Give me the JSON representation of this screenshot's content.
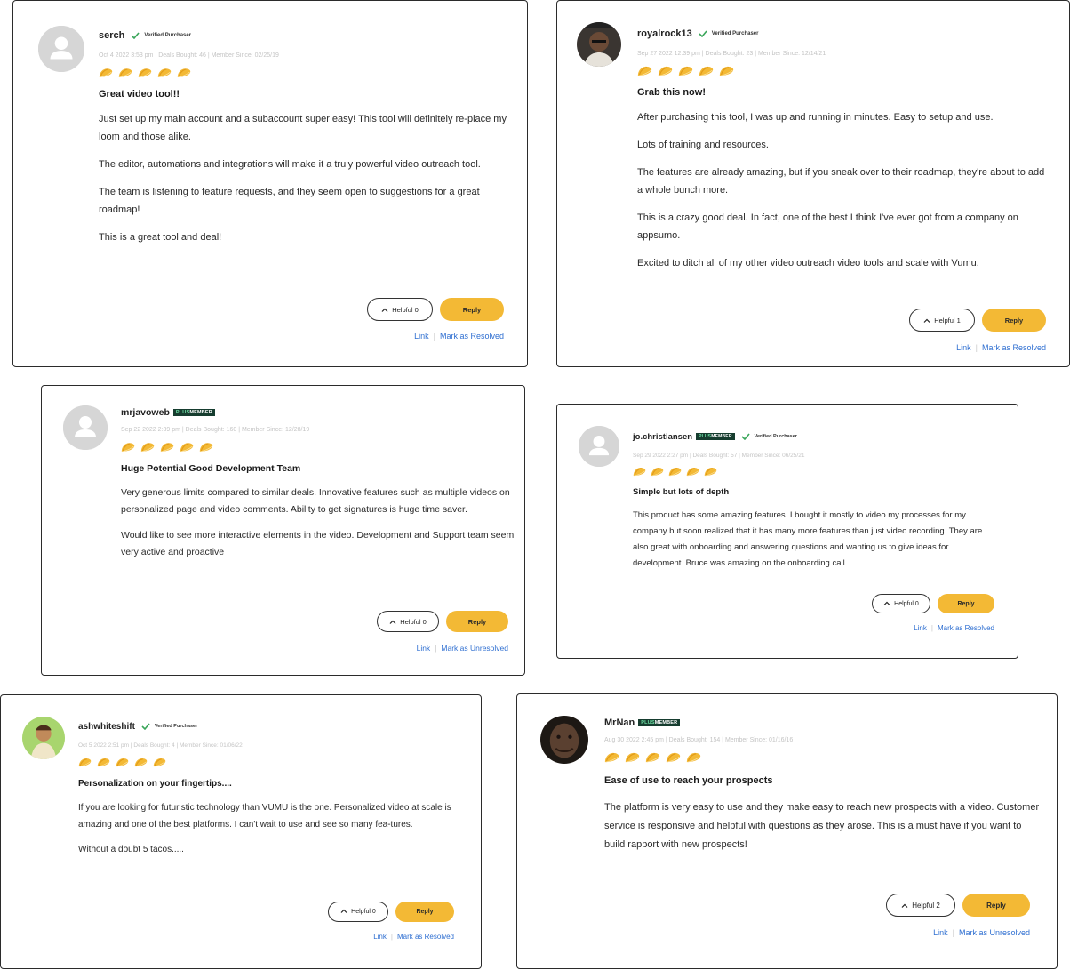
{
  "labels": {
    "verified": "Verified Purchaser",
    "plus": "PLUS",
    "member": "MEMBER",
    "helpful_prefix": "Helpful",
    "reply": "Reply",
    "link": "Link"
  },
  "colors": {
    "reply_button": "#f3b935",
    "link": "#2f6fd1",
    "verified_check": "#3aa65a",
    "plus_badge_bg": "#163d2f",
    "taco": "#f3b935"
  },
  "reviews": [
    {
      "username": "serch",
      "verified": true,
      "plus_member": false,
      "meta": "Oct 4 2022 3:53 pm | Deals Bought: 46 | Member Since: 02/25/19",
      "rating": 5,
      "title": "Great video tool!!",
      "paragraphs": [
        "Just set up my main account and a subaccount super easy! This tool will definitely re-place my loom and those alike.",
        "The editor, automations and integrations will make it a truly powerful video outreach tool.",
        "The team is listening to feature requests, and they seem open to suggestions for a great roadmap!",
        "This is a great tool and deal!"
      ],
      "helpful_count": "0",
      "resolve_label": "Mark as Resolved"
    },
    {
      "username": "royalrock13",
      "verified": true,
      "plus_member": false,
      "meta": "Sep 27 2022 12:39 pm | Deals Bought: 23 | Member Since: 12/14/21",
      "rating": 5,
      "title": "Grab this now!",
      "paragraphs": [
        "After purchasing this tool, I was up and running in minutes. Easy to setup and use.",
        "Lots of training and resources.",
        "The features are already amazing, but if you sneak over to their roadmap, they're about to add a whole bunch more.",
        "This is a crazy good deal. In fact, one of the best I think I've ever got from a company on appsumo.",
        "Excited to ditch all of my other video outreach video tools and scale with Vumu."
      ],
      "helpful_count": "1",
      "resolve_label": "Mark as Resolved"
    },
    {
      "username": "mrjavoweb",
      "verified": false,
      "plus_member": true,
      "meta": "Sep 22 2022 2:39 pm | Deals Bought: 160 | Member Since: 12/28/19",
      "rating": 5,
      "title": "Huge Potential Good Development Team",
      "paragraphs": [
        "Very generous limits compared to similar deals. Innovative features such as multiple videos on personalized page and video comments. Ability to get signatures is huge time saver.",
        "Would like to see more interactive elements in the video. Development and Support team seem very active and proactive"
      ],
      "helpful_count": "0",
      "resolve_label": "Mark as Unresolved"
    },
    {
      "username": "jo.christiansen",
      "verified": true,
      "plus_member": true,
      "meta": "Sep 29 2022 2:27 pm | Deals Bought: 57 | Member Since: 06/25/21",
      "rating": 5,
      "title": "Simple but lots of depth",
      "paragraphs": [
        "This product has some amazing features. I bought it mostly to video my processes for my company but soon realized that it has many more features than just video recording. They are also great with onboarding and answering questions and wanting us to give ideas for development. Bruce was amazing on the onboarding call."
      ],
      "helpful_count": "0",
      "resolve_label": "Mark as Resolved"
    },
    {
      "username": "ashwhiteshift",
      "verified": true,
      "plus_member": false,
      "meta": "Oct 5 2022 2:51 pm | Deals Bought: 4 | Member Since: 01/06/22",
      "rating": 5,
      "title": "Personalization on your fingertips....",
      "paragraphs": [
        "If you are looking for futuristic technology than VUMU is the one. Personalized video at scale is amazing and one of the best platforms. I can't wait to use and see so many fea-tures.",
        "Without a doubt 5 tacos....."
      ],
      "helpful_count": "0",
      "resolve_label": "Mark as Resolved"
    },
    {
      "username": "MrNan",
      "verified": false,
      "plus_member": true,
      "meta": "Aug 30 2022 2:45 pm | Deals Bought: 154 | Member Since: 01/16/16",
      "rating": 5,
      "title": "Ease of use to reach your prospects",
      "paragraphs": [
        "The platform is very easy to use and they make easy to reach new prospects with a video. Customer service is responsive and helpful with questions as they arose. This is a must have if you want to build rapport with new prospects!"
      ],
      "helpful_count": "2",
      "resolve_label": "Mark as Unresolved"
    }
  ]
}
